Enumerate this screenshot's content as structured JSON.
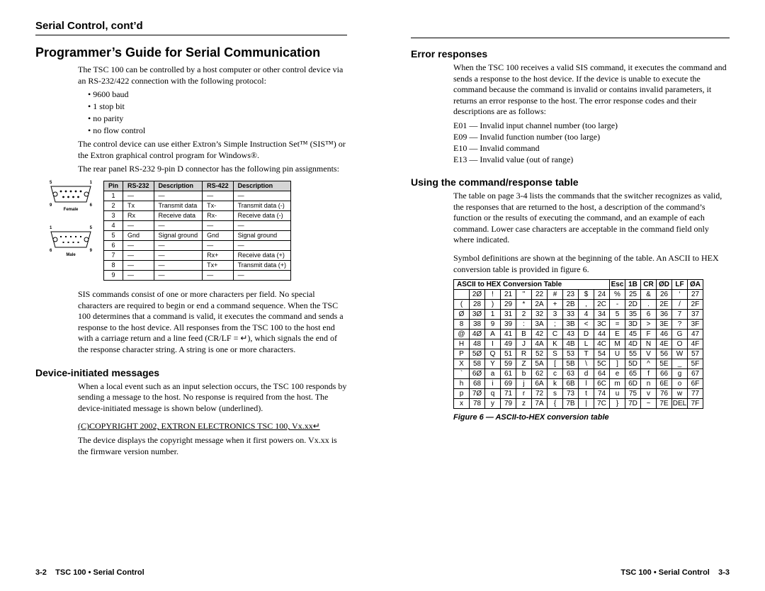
{
  "runningHead": "Serial Control, cont’d",
  "left": {
    "h1": "Programmer’s Guide for Serial Communication",
    "intro": "The TSC 100 can be controlled by a host computer or other control device via an RS-232/422 connection with the following protocol:",
    "bullets": [
      "9600 baud",
      "1 stop bit",
      "no parity",
      "no flow control"
    ],
    "para2": "The control device can use either Extron’s Simple Instruction Set™ (SIS™) or the Extron graphical control program for Windows®.",
    "para3": "The rear panel RS-232 9-pin D connector has the following pin assignments:",
    "pinHeader": [
      "Pin",
      "RS-232",
      "Description",
      "RS-422",
      "Description"
    ],
    "pinRows": [
      [
        "1",
        "—",
        "—",
        "—",
        "—"
      ],
      [
        "2",
        "Tx",
        "Transmit data",
        "Tx-",
        "Transmit data (-)"
      ],
      [
        "3",
        "Rx",
        "Receive data",
        "Rx-",
        "Receive data (-)"
      ],
      [
        "4",
        "—",
        "—",
        "—",
        "—"
      ],
      [
        "5",
        "Gnd",
        "Signal ground",
        "Gnd",
        "Signal ground"
      ],
      [
        "6",
        "—",
        "—",
        "—",
        "—"
      ],
      [
        "7",
        "—",
        "—",
        "Rx+",
        "Receive data (+)"
      ],
      [
        "8",
        "—",
        "—",
        "Tx+",
        "Transmit data (+)"
      ],
      [
        "9",
        "—",
        "—",
        "—",
        "—"
      ]
    ],
    "db9FemaleLabels": {
      "tl": "5",
      "tr": "1",
      "bl": "9",
      "br": "6",
      "cap": "Female"
    },
    "db9MaleLabels": {
      "tl": "1",
      "tr": "5",
      "bl": "6",
      "br": "9",
      "cap": "Male"
    },
    "para4": "SIS commands consist of one or more characters per field.  No special characters are required to begin or end a command sequence.  When the TSC 100 determines that a command is valid, it executes the command and sends a response to the host device.  All responses from the TSC 100 to the host end with a carriage return and a line feed (CR/LF = ↵), which signals the end of the response character string.  A string is one or more characters.",
    "h2": "Device-initiated messages",
    "para5": "When a local event such as an input selection occurs, the TSC 100 responds by sending a message to the host.  No response is required from the host.  The device-initiated message is shown below (underlined).",
    "copyright": "(C)COPYRIGHT 2002, EXTRON ELECTRONICS TSC 100, Vx.xx↵",
    "para6": "The device displays the copyright message when it first powers on.  Vx.xx is the firmware version number.",
    "footerPage": "3-2",
    "footerText": "TSC 100 • Serial Control"
  },
  "right": {
    "errH2": "Error responses",
    "errPara": "When the TSC 100 receives a valid SIS command, it executes the command and sends a response to the host device.  If the device is unable to execute the command because the command is invalid or contains invalid parameters, it returns an error response to the host.  The error response codes and their descriptions are as follows:",
    "errors": [
      "E01 — Invalid input channel number (too large)",
      "E09 — Invalid function number (too large)",
      "E10 — Invalid command",
      "E13 — Invalid value (out of range)"
    ],
    "useH2": "Using the command/response table",
    "usePara1": "The table on page 3-4 lists the commands that the switcher recognizes as valid, the responses that are returned to the host, a description of the command’s function or the results of executing the command, and an example of each command. Lower case characters are acceptable in the command field only where indicated.",
    "usePara2": "Symbol definitions are shown at the beginning of the table.  An ASCII to HEX conversion table is provided in figure 6.",
    "asciiTitle": "ASCII to HEX  Conversion Table",
    "asciiHeadRight": [
      "Esc",
      "1B",
      "CR",
      "ØD",
      "LF",
      "ØA"
    ],
    "asciiRows": [
      [
        " ",
        "2Ø",
        "!",
        "21",
        "\"",
        "22",
        "#",
        "23",
        "$",
        "24",
        "%",
        "25",
        "&",
        "26",
        "‘",
        "27"
      ],
      [
        "(",
        "28",
        ")",
        "29",
        "*",
        "2A",
        "+",
        "2B",
        ",",
        "2C",
        "-",
        "2D",
        ".",
        "2E",
        "/",
        "2F"
      ],
      [
        "Ø",
        "3Ø",
        "1",
        "31",
        "2",
        "32",
        "3",
        "33",
        "4",
        "34",
        "5",
        "35",
        "6",
        "36",
        "7",
        "37"
      ],
      [
        "8",
        "38",
        "9",
        "39",
        ":",
        "3A",
        ";",
        "3B",
        "<",
        "3C",
        "=",
        "3D",
        ">",
        "3E",
        "?",
        "3F"
      ],
      [
        "@",
        "4Ø",
        "A",
        "41",
        "B",
        "42",
        "C",
        "43",
        "D",
        "44",
        "E",
        "45",
        "F",
        "46",
        "G",
        "47"
      ],
      [
        "H",
        "48",
        "I",
        "49",
        "J",
        "4A",
        "K",
        "4B",
        "L",
        "4C",
        "M",
        "4D",
        "N",
        "4E",
        "O",
        "4F"
      ],
      [
        "P",
        "5Ø",
        "Q",
        "51",
        "R",
        "52",
        "S",
        "53",
        "T",
        "54",
        "U",
        "55",
        "V",
        "56",
        "W",
        "57"
      ],
      [
        "X",
        "58",
        "Y",
        "59",
        "Z",
        "5A",
        "[",
        "5B",
        "\\",
        "5C",
        "]",
        "5D",
        "^",
        "5E",
        "_",
        "5F"
      ],
      [
        "`",
        "6Ø",
        "a",
        "61",
        "b",
        "62",
        "c",
        "63",
        "d",
        "64",
        "e",
        "65",
        "f",
        "66",
        "g",
        "67"
      ],
      [
        "h",
        "68",
        "i",
        "69",
        "j",
        "6A",
        "k",
        "6B",
        "l",
        "6C",
        "m",
        "6D",
        "n",
        "6E",
        "o",
        "6F"
      ],
      [
        "p",
        "7Ø",
        "q",
        "71",
        "r",
        "72",
        "s",
        "73",
        "t",
        "74",
        "u",
        "75",
        "v",
        "76",
        "w",
        "77"
      ],
      [
        "x",
        "78",
        "y",
        "79",
        "z",
        "7A",
        "{",
        "7B",
        "|",
        "7C",
        "}",
        "7D",
        "~",
        "7E",
        "DEL",
        "7F"
      ]
    ],
    "caption": "Figure 6 — ASCII-to-HEX conversion table",
    "footerText": "TSC 100 • Serial Control",
    "footerPage": "3-3"
  }
}
